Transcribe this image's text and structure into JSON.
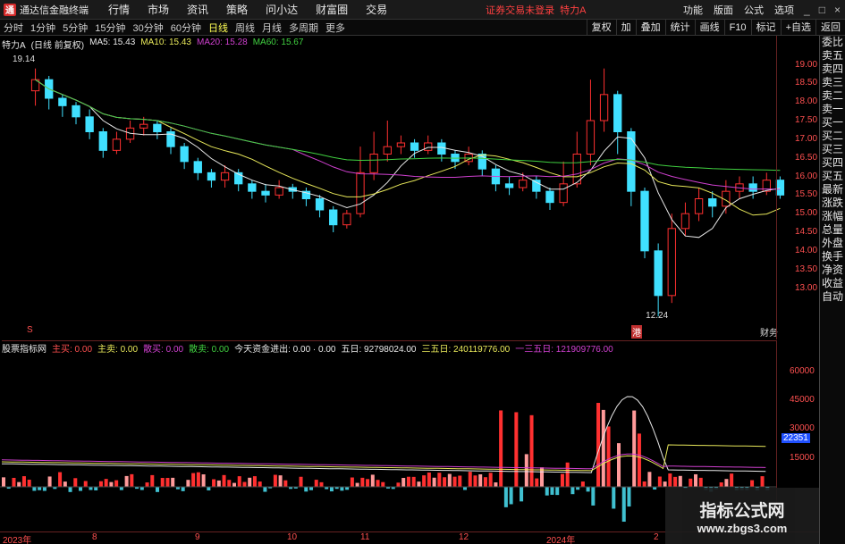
{
  "titlebar": {
    "app_title": "通达信金融终端",
    "menu": [
      "行情",
      "市场",
      "资讯",
      "策略",
      "问小达",
      "财富圈",
      "交易"
    ],
    "login_status": "证券交易未登录",
    "stock_name": "特力A",
    "right_menu": [
      "功能",
      "版面",
      "公式",
      "选项"
    ],
    "window_buttons": [
      "_",
      "□",
      "×"
    ]
  },
  "periodbar": {
    "tabs": [
      "分时",
      "1分钟",
      "5分钟",
      "15分钟",
      "30分钟",
      "60分钟",
      "日线",
      "周线",
      "月线",
      "多周期",
      "更多"
    ],
    "active": "日线",
    "tool_buttons": [
      "复权",
      "加",
      "叠加",
      "统计",
      "画线",
      "F10",
      "标记",
      "+自选",
      "返回"
    ]
  },
  "legend": {
    "stock": "特力A",
    "adjust": "(日线 前复权)",
    "ma5": "MA5: 15.43",
    "ma10": "MA10: 15.43",
    "ma20": "MA20: 15.28",
    "ma60": "MA60: 15.67"
  },
  "colors": {
    "ma5": "#e8e8e8",
    "ma10": "#e8e85a",
    "ma20": "#d040d0",
    "ma60": "#40d040",
    "up": "#ff3030",
    "down": "#40e0ff",
    "axis": "#ff5050"
  },
  "chart_data": {
    "type": "line",
    "price_axis": [
      19.0,
      18.5,
      18.0,
      17.5,
      17.0,
      16.5,
      16.0,
      15.5,
      15.0,
      14.5,
      14.0,
      13.5,
      13.0
    ],
    "high_label": "19.14",
    "low_label": "12.24",
    "date_ticks": [
      "2023年",
      "8",
      "9",
      "10",
      "11",
      "12",
      "2024年",
      "2"
    ],
    "candles": [
      [
        18.3,
        18.6,
        18.9,
        17.9
      ],
      [
        18.6,
        18.1,
        18.7,
        17.8
      ],
      [
        18.1,
        17.9,
        18.2,
        17.6
      ],
      [
        17.9,
        17.6,
        18.0,
        17.4
      ],
      [
        17.6,
        17.2,
        17.8,
        17.0
      ],
      [
        17.2,
        16.7,
        17.3,
        16.5
      ],
      [
        16.7,
        17.0,
        17.2,
        16.6
      ],
      [
        17.0,
        17.3,
        17.5,
        16.9
      ],
      [
        17.3,
        17.4,
        17.6,
        17.1
      ],
      [
        17.4,
        17.2,
        17.5,
        17.0
      ],
      [
        17.2,
        16.8,
        17.3,
        16.6
      ],
      [
        16.8,
        16.4,
        16.9,
        16.2
      ],
      [
        16.4,
        16.1,
        16.5,
        15.9
      ],
      [
        16.1,
        15.9,
        16.2,
        15.7
      ],
      [
        15.9,
        16.1,
        16.3,
        15.7
      ],
      [
        16.1,
        15.8,
        16.2,
        15.6
      ],
      [
        15.8,
        15.6,
        15.9,
        15.4
      ],
      [
        15.6,
        15.5,
        15.8,
        15.3
      ],
      [
        15.5,
        15.7,
        15.9,
        15.4
      ],
      [
        15.7,
        15.6,
        15.8,
        15.4
      ],
      [
        15.6,
        15.4,
        15.7,
        15.2
      ],
      [
        15.4,
        15.1,
        15.5,
        14.9
      ],
      [
        15.1,
        14.7,
        15.2,
        14.5
      ],
      [
        14.7,
        15.0,
        15.1,
        14.6
      ],
      [
        15.0,
        16.1,
        16.8,
        14.9
      ],
      [
        16.1,
        16.6,
        17.2,
        15.9
      ],
      [
        16.6,
        16.8,
        17.5,
        16.4
      ],
      [
        16.8,
        16.9,
        17.1,
        16.6
      ],
      [
        16.9,
        16.7,
        17.0,
        16.5
      ],
      [
        16.7,
        16.9,
        17.1,
        16.6
      ],
      [
        16.9,
        16.6,
        17.0,
        16.4
      ],
      [
        16.6,
        16.4,
        16.7,
        16.2
      ],
      [
        16.4,
        16.6,
        16.8,
        16.3
      ],
      [
        16.6,
        16.2,
        16.7,
        16.0
      ],
      [
        16.2,
        15.8,
        16.3,
        15.6
      ],
      [
        15.8,
        15.7,
        16.0,
        15.5
      ],
      [
        15.7,
        15.9,
        16.1,
        15.6
      ],
      [
        15.9,
        15.6,
        16.0,
        15.4
      ],
      [
        15.6,
        15.3,
        15.7,
        15.1
      ],
      [
        15.3,
        15.8,
        16.4,
        15.2
      ],
      [
        15.8,
        16.6,
        17.2,
        15.7
      ],
      [
        16.6,
        17.5,
        18.6,
        16.3
      ],
      [
        17.5,
        18.2,
        18.9,
        17.2
      ],
      [
        18.2,
        17.2,
        18.3,
        16.6
      ],
      [
        17.2,
        15.6,
        17.3,
        15.2
      ],
      [
        15.6,
        14.0,
        15.7,
        13.8
      ],
      [
        14.0,
        12.8,
        14.2,
        12.24
      ],
      [
        12.8,
        14.6,
        15.0,
        12.6
      ],
      [
        14.6,
        15.0,
        15.3,
        14.4
      ],
      [
        15.0,
        15.4,
        15.7,
        14.8
      ],
      [
        15.4,
        15.2,
        15.6,
        14.9
      ],
      [
        15.2,
        15.6,
        15.9,
        15.0
      ],
      [
        15.6,
        15.8,
        16.0,
        15.4
      ],
      [
        15.8,
        15.6,
        16.0,
        15.4
      ],
      [
        15.6,
        15.9,
        16.1,
        15.5
      ],
      [
        15.9,
        15.5,
        16.0,
        15.4
      ]
    ]
  },
  "indicator": {
    "name": "股票指标网",
    "items": [
      {
        "label": "主买: 0.00",
        "color": "#ff5050"
      },
      {
        "label": "主卖: 0.00",
        "color": "#e8e85a"
      },
      {
        "label": "散买: 0.00",
        "color": "#d040d0"
      },
      {
        "label": "散卖: 0.00",
        "color": "#40d040"
      },
      {
        "label": "今天资金进出: 0.00 · 0.00",
        "color": "#e8e8e8"
      },
      {
        "label": "五日: 92798024.00",
        "color": "#e8e8e8"
      },
      {
        "label": "三五日: 240119776.00",
        "color": "#e8e85a"
      },
      {
        "label": "一三五日: 121909776.00",
        "color": "#d040d0"
      }
    ],
    "axis": [
      60000,
      45000,
      30000,
      15000
    ],
    "current_value": "22351"
  },
  "side_panel": [
    "委比",
    "卖五",
    "卖四",
    "卖三",
    "卖二",
    "卖一",
    "买一",
    "买二",
    "买三",
    "买四",
    "买五",
    "最新",
    "涨跌",
    "涨幅",
    "总量",
    "外盘",
    "换手",
    "净资",
    "收益",
    "自动"
  ],
  "markers": {
    "left_marker": "S",
    "right_marker": "财务",
    "low_marker": "港"
  },
  "watermark": {
    "title": "指标公式网",
    "url": "www.zbgs3.com"
  }
}
